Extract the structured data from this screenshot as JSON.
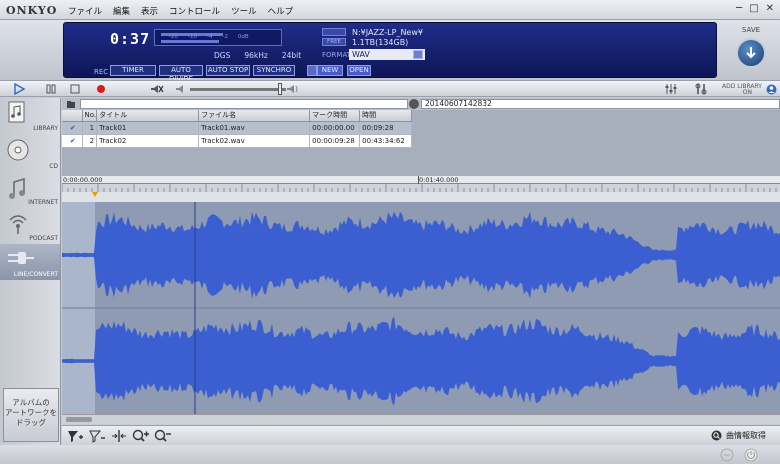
{
  "app": {
    "logo": "ONKYO",
    "menu": [
      "ファイル",
      "編集",
      "表示",
      "コントロール",
      "ツール",
      "ヘルプ"
    ]
  },
  "display": {
    "time": "0:37",
    "meter_ticks": [
      "-20",
      "-10",
      "-4",
      "-2",
      "0dB"
    ],
    "dest_folder": "N:¥JAZZ-LP_New¥",
    "free_label": "FREE",
    "disk_free": "1.1TB(134GB)",
    "dgs": "DGS",
    "sample_rate": "96kHz",
    "bit_depth": "24bit",
    "format_label": "FORMAT",
    "format": "WAV",
    "rec_label": "REC",
    "buttons": {
      "timer": "TIMER",
      "auto_divide": "AUTO DIVIDE",
      "auto_stop": "AUTO STOP",
      "synchro": "SYNCHRO",
      "new": "NEW",
      "open": "OPEN"
    },
    "save_label": "SAVE"
  },
  "transport": {
    "add_library": "ADD LIBRARY",
    "add_library_state": "ON"
  },
  "sidebar": {
    "items": [
      {
        "label": "LIBRARY",
        "icon": "library-icon"
      },
      {
        "label": "CD",
        "icon": "cd-icon"
      },
      {
        "label": "INTERNET",
        "icon": "internet-icon"
      },
      {
        "label": "PODCAST",
        "icon": "podcast-icon"
      },
      {
        "label": "LINE/CONVERT",
        "icon": "line-convert-icon"
      }
    ],
    "active": "LINE/CONVERT",
    "artwork_text": [
      "アルバムの",
      "アートワークを",
      "ドラッグ"
    ]
  },
  "recording": {
    "folder_name": "",
    "date_label": "20140607142832",
    "columns": [
      "No.",
      "タイトル",
      "ファイル名",
      "マーク時間",
      "時間"
    ],
    "rows": [
      {
        "no": "1",
        "title": "Track01",
        "file": "Track01.wav",
        "mark": "00:00:00.00",
        "duration": "00:09:28",
        "checked": true
      },
      {
        "no": "2",
        "title": "Track02",
        "file": "Track02.wav",
        "mark": "00:00:09:28",
        "duration": "00:43:34:62",
        "checked": true
      }
    ]
  },
  "timeline": {
    "start": "0:00:00.000",
    "mid": "0:01:40.000"
  },
  "bottom": {
    "track_info_label": "曲情報取得"
  },
  "colors": {
    "lcd_bg": "#18237a",
    "waveform": "#3b5fd0",
    "waveform_bg": "#8e9bb3",
    "marker": "#e8a000"
  }
}
